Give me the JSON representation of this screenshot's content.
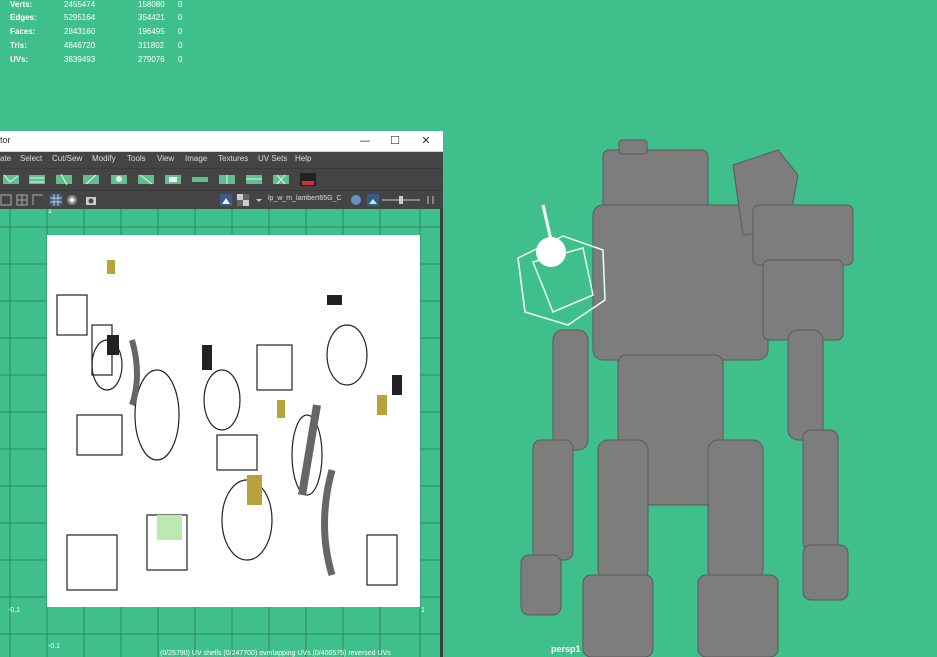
{
  "hud": {
    "rows": [
      {
        "label": "Verts:",
        "v1": "2455474",
        "v2": "158080",
        "v3": "0"
      },
      {
        "label": "Edges:",
        "v1": "5295164",
        "v2": "354421",
        "v3": "0"
      },
      {
        "label": "Faces:",
        "v1": "2843160",
        "v2": "196495",
        "v3": "0"
      },
      {
        "label": "Tris:",
        "v1": "4846720",
        "v2": "311802",
        "v3": "0"
      },
      {
        "label": "UVs:",
        "v1": "3839493",
        "v2": "279076",
        "v3": "0"
      }
    ]
  },
  "uv_editor": {
    "title": "tor",
    "window_buttons": {
      "minimize": "—",
      "maximize": "☐",
      "close": "✕"
    },
    "menu": [
      "ate",
      "Select",
      "Cut/Sew",
      "Modify",
      "Tools",
      "View",
      "Image",
      "Textures",
      "UV Sets",
      "Help"
    ],
    "shader_label": "lp_w_m_lambert65G_C",
    "axis": {
      "top": "1",
      "left_bottom": "-0.1",
      "right_bottom": "1",
      "bottom": "-0.1"
    },
    "status": "(0/25790) UV shells   (0/247700) overlapping UVs   (0/400575) reversed UVs"
  },
  "viewport": {
    "camera": "persp1",
    "bg_color": "#3fbf8b"
  }
}
